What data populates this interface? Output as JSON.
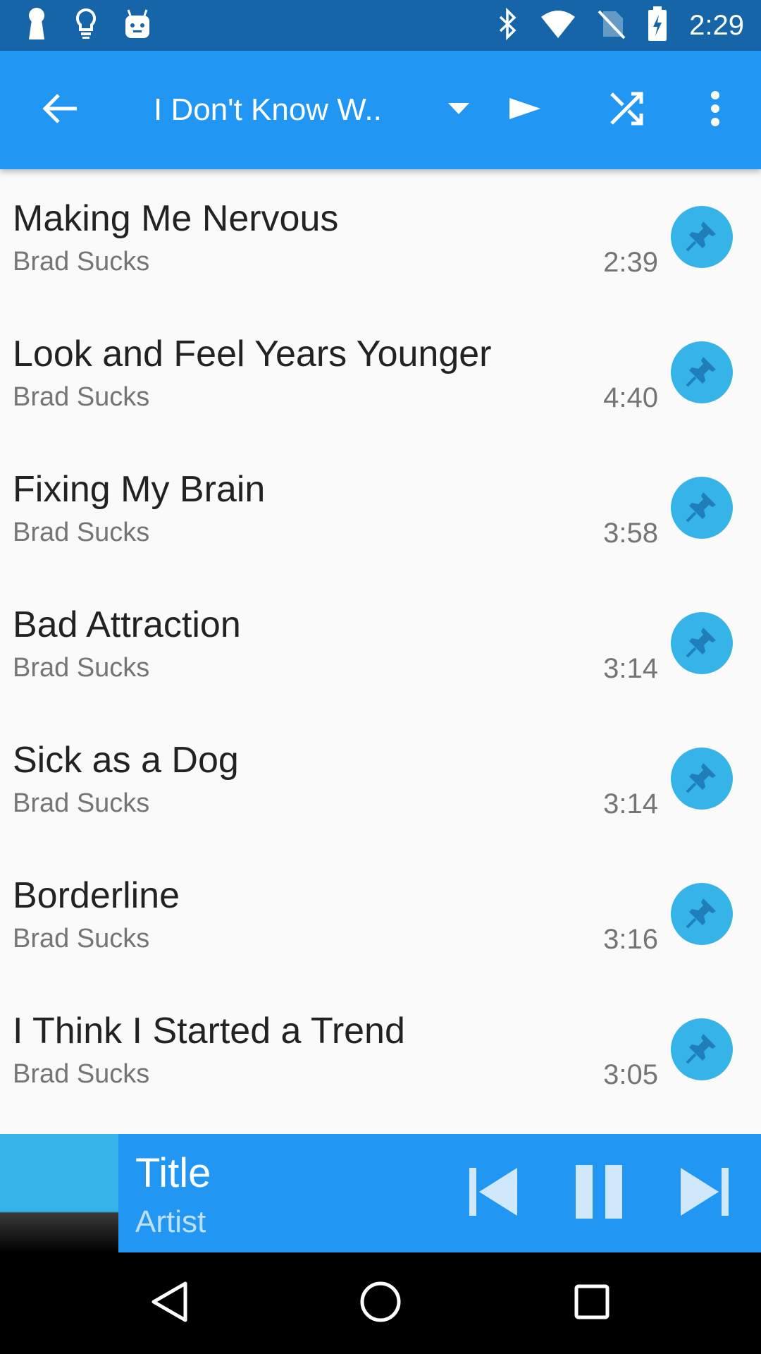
{
  "status_bar": {
    "time": "2:29",
    "icons": [
      "keyhole-icon",
      "lightbulb-icon",
      "android-icon",
      "bluetooth-icon",
      "wifi-icon",
      "no-sim-icon",
      "battery-charging-icon"
    ]
  },
  "app_bar": {
    "title": "I Don't Know W..",
    "icons": [
      "back-arrow-icon",
      "dropdown-arrow-icon",
      "play-icon",
      "shuffle-icon",
      "more-vert-icon"
    ],
    "color": "#2196f3"
  },
  "tracks": [
    {
      "title": "Making Me Nervous",
      "artist": "Brad Sucks",
      "duration": "2:39"
    },
    {
      "title": "Look and Feel Years Younger",
      "artist": "Brad Sucks",
      "duration": "4:40"
    },
    {
      "title": "Fixing My Brain",
      "artist": "Brad Sucks",
      "duration": "3:58"
    },
    {
      "title": "Bad Attraction",
      "artist": "Brad Sucks",
      "duration": "3:14"
    },
    {
      "title": "Sick as a Dog",
      "artist": "Brad Sucks",
      "duration": "3:14"
    },
    {
      "title": "Borderline",
      "artist": "Brad Sucks",
      "duration": "3:16"
    },
    {
      "title": "I Think I Started a Trend",
      "artist": "Brad Sucks",
      "duration": "3:05"
    }
  ],
  "track_action_icon": "pin-icon",
  "now_playing": {
    "title": "Title",
    "artist": "Artist",
    "controls": [
      "skip-previous-icon",
      "pause-icon",
      "skip-next-icon"
    ]
  },
  "nav_bar": {
    "icons": [
      "nav-back-icon",
      "nav-home-icon",
      "nav-recents-icon"
    ]
  }
}
